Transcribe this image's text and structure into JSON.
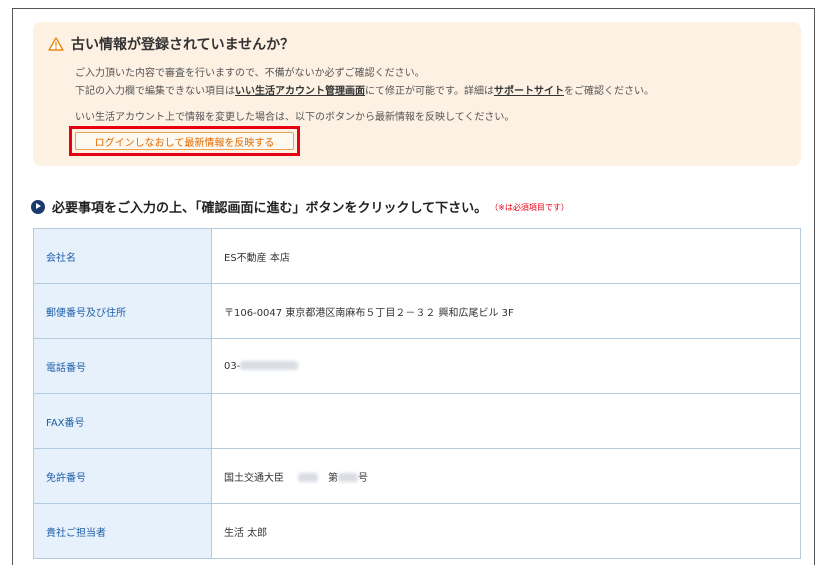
{
  "notice": {
    "title": "古い情報が登録されていませんか？",
    "line1": "ご入力頂いた内容で審査を行いますので、不備がないか必ずご確認ください。",
    "line2_pre": "下記の入力欄で編集できない項目は",
    "line2_link1": "いい生活アカウント管理画面",
    "line2_mid": "にて修正が可能です。詳細は",
    "line2_link2": "サポートサイト",
    "line2_post": "をご確認ください。",
    "line3": "いい生活アカウント上で情報を変更した場合は、以下のボタンから最新情報を反映してください。",
    "button_label": "ログインしなおして最新情報を反映する",
    "icon": "warning-icon"
  },
  "section": {
    "title": "必要事項をご入力の上、「確認画面に進む」ボタンをクリックして下さい。",
    "note": "（※は必須項目です）"
  },
  "form": {
    "rows": [
      {
        "label": "会社名",
        "value": "ES不動産 本店"
      },
      {
        "label": "郵便番号及び住所",
        "value": "〒106-0047 東京都港区南麻布５丁目２－３２ 興和広尾ビル 3F"
      },
      {
        "label": "電話番号",
        "value_prefix": "03-"
      },
      {
        "label": "FAX番号",
        "value": ""
      },
      {
        "label": "免許番号",
        "value_pre": "国土交通大臣",
        "value_mid": "第",
        "value_post": "号"
      },
      {
        "label": "貴社ご担当者",
        "value": "生活 太郎"
      }
    ]
  },
  "colors": {
    "notice_bg": "#fdf1e4",
    "highlight": "#e60012",
    "label_bg": "#e7f1fb",
    "label_text": "#1f5ea8",
    "button_text": "#e06a00"
  }
}
